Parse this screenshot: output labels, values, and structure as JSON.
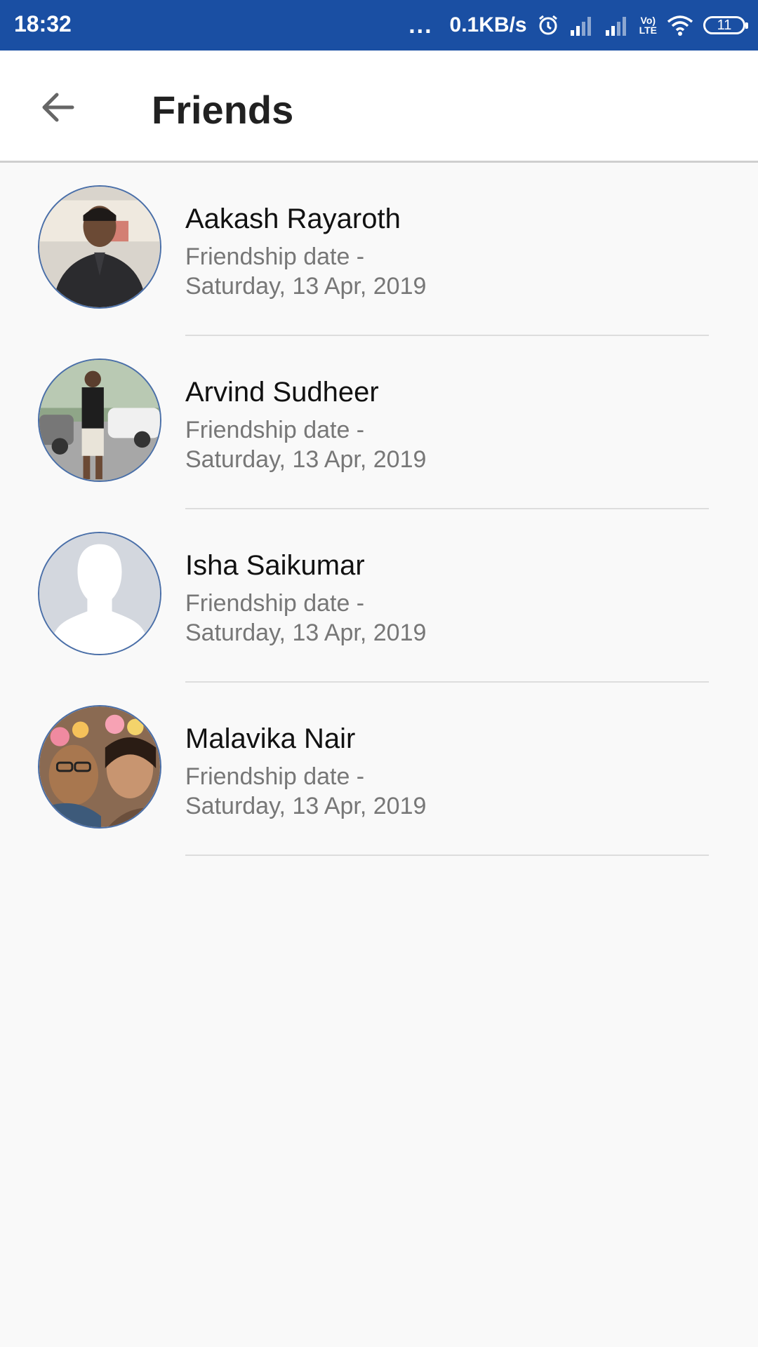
{
  "status_bar": {
    "time": "18:32",
    "dots": "...",
    "speed": "0.1KB/s",
    "lte_top": "Vo)",
    "lte_bottom": "LTE",
    "battery": "11",
    "icons": [
      "alarm-icon",
      "signal-icon",
      "signal-icon",
      "volte-icon",
      "wifi-icon",
      "battery-icon"
    ]
  },
  "app_bar": {
    "back_icon": "arrow-left-icon",
    "title": "Friends"
  },
  "friends": [
    {
      "name": "Aakash Rayaroth",
      "label": "Friendship date -",
      "date": "Saturday, 13 Apr, 2019",
      "avatar": "photo"
    },
    {
      "name": "Arvind Sudheer",
      "label": "Friendship date -",
      "date": "Saturday, 13 Apr, 2019",
      "avatar": "photo"
    },
    {
      "name": "Isha Saikumar",
      "label": "Friendship date -",
      "date": "Saturday, 13 Apr, 2019",
      "avatar": "default-silhouette"
    },
    {
      "name": "Malavika Nair",
      "label": "Friendship date -",
      "date": "Saturday, 13 Apr, 2019",
      "avatar": "photo"
    }
  ],
  "colors": {
    "status_bar": "#1a4fa3",
    "background": "#f9f9f9",
    "avatar_border": "#4a6fa8"
  }
}
